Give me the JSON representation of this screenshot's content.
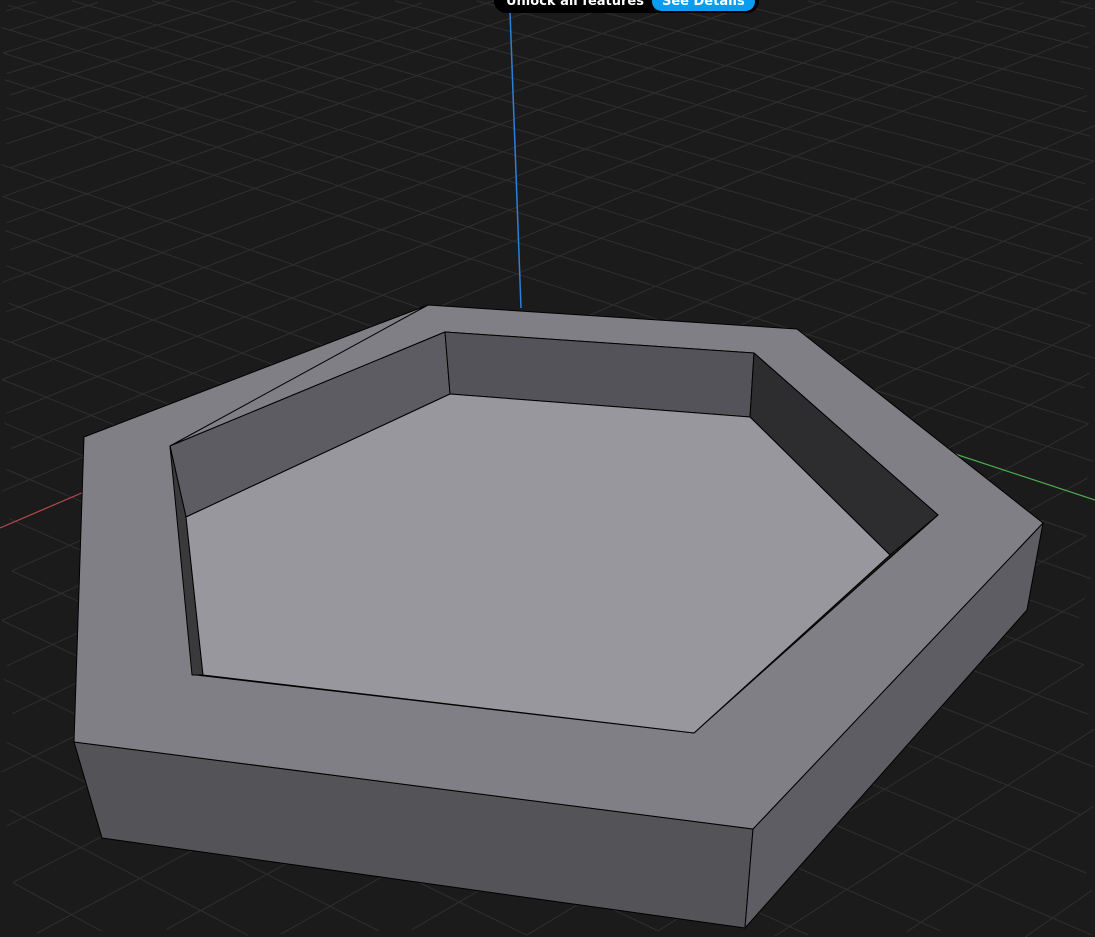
{
  "banner": {
    "text": "Unlock all features",
    "button_label": "See Details"
  },
  "colors": {
    "background": "#1b1b1b",
    "grid": "#2f2f2f",
    "axis_x": "#b84a4a",
    "axis_y": "#4fa84f",
    "axis_z": "#2f7fd8",
    "accent": "#0a9cf0"
  }
}
